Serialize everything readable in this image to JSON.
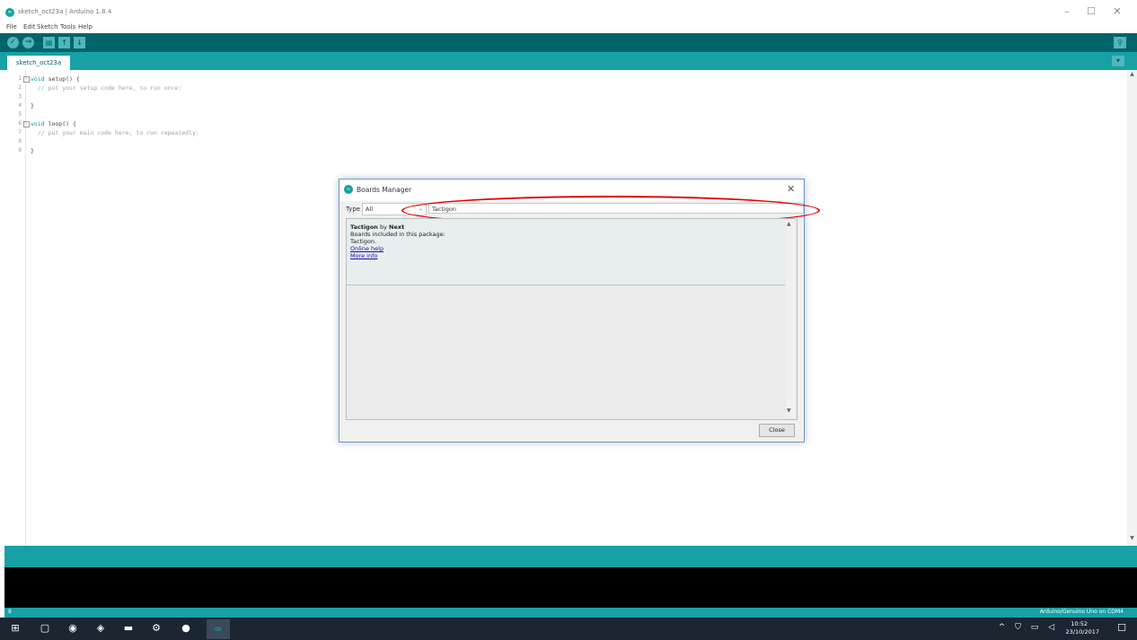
{
  "window": {
    "title": "sketch_oct23a | Arduino 1.8.4",
    "app_icon": "∞",
    "controls": [
      "–",
      "☐",
      "✕"
    ]
  },
  "menu": [
    "File",
    "Edit",
    "Sketch",
    "Tools",
    "Help"
  ],
  "toolbar": {
    "verify_icon": "✓",
    "upload_icon": "→",
    "new_icon": "▤",
    "open_icon": "↑",
    "save_icon": "↓",
    "serial_monitor_icon": "⚲"
  },
  "tab": {
    "label": "sketch_oct23a",
    "menu_icon": "▾"
  },
  "editor": {
    "line_numbers": [
      "1",
      "2",
      "3",
      "4",
      "5",
      "6",
      "7",
      "8",
      "9"
    ],
    "lines": [
      {
        "kw": "void",
        "rest": " setup() {"
      },
      {
        "comment": "  // put your setup code here, to run once:"
      },
      {
        "text": ""
      },
      {
        "text": "}"
      },
      {
        "text": ""
      },
      {
        "kw": "void",
        "rest": " loop() {"
      },
      {
        "comment": "  // put your main code here, to run repeatedly:"
      },
      {
        "text": ""
      },
      {
        "text": "}"
      }
    ]
  },
  "status": {
    "line": "8",
    "board": "Arduino/Genuino Uno on COM4"
  },
  "dialog": {
    "title": "Boards Manager",
    "icon": "∞",
    "close_x": "✕",
    "type_label": "Type",
    "type_value": "All",
    "search_value": "Tactigon",
    "item": {
      "name": "Tactigon",
      "by": " by ",
      "author": "Next",
      "boards_label": "Boards included in this package:",
      "boards": "Tactigon.",
      "online_help": "Online help",
      "more_info": "More info"
    },
    "close_button": "Close"
  },
  "taskbar": {
    "time": "10:52",
    "date": "23/10/2017",
    "tray": "^ ⛉ ▭ ◁",
    "icons": [
      "⊞",
      "▢",
      "◉",
      "◈",
      "▬",
      "⚙",
      "●",
      "∞"
    ]
  },
  "colors": {
    "toolbar": "#006468",
    "tabbar": "#17a1a5",
    "highlight": "#e00000"
  }
}
